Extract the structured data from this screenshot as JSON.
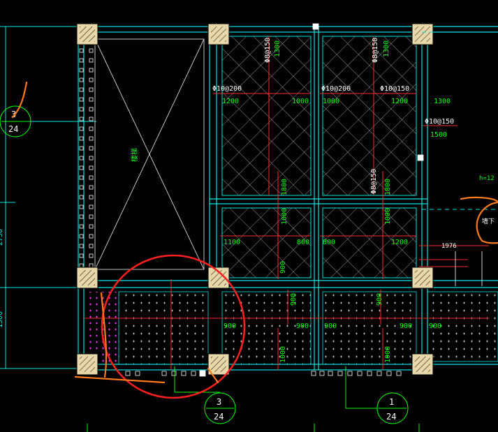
{
  "colors": {
    "background": "#000000",
    "wall": "#00e5e5",
    "column_fill": "#e8d7a8",
    "rebar": "#ff2a2a",
    "dim_text": "#00ff00",
    "annot_text": "#ffffff",
    "markup_red": "#ff2020",
    "markup_orange": "#ff7a1a",
    "hatch_slab": "#cfcfcf",
    "hatch_magenta": "#ff30ff"
  },
  "labels": {
    "rebar_a": "Φ8@150",
    "rebar_b": "Φ10@200",
    "rebar_c": "Φ10@150",
    "rebar_d": "Φ8@150",
    "len_1300": "1300",
    "len_1200": "1200",
    "len_1000": "1000",
    "len_1500": "1500",
    "len_1800": "1800",
    "len_900": "900",
    "len_1976": "1976",
    "opening": "楼梯",
    "h_note": "h=12",
    "side_note": "墙下"
  },
  "section_marks": [
    {
      "num": "3",
      "den": "24"
    },
    {
      "num": "3",
      "den": "24"
    },
    {
      "num": "1",
      "den": "24"
    }
  ]
}
